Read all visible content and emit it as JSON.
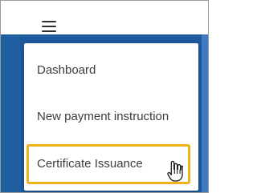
{
  "topbar": {
    "menu_icon": "hamburger-menu-icon"
  },
  "menu": {
    "items": [
      {
        "label": "Dashboard"
      },
      {
        "label": "New payment instruction"
      },
      {
        "label": "Certificate Issuance",
        "highlighted": true
      }
    ]
  },
  "cursor": {
    "icon": "hand-pointer-cursor"
  },
  "colors": {
    "highlight_border": "#f0b21a",
    "app_blue": "#1e5a9e",
    "text": "#3d3d3d"
  }
}
